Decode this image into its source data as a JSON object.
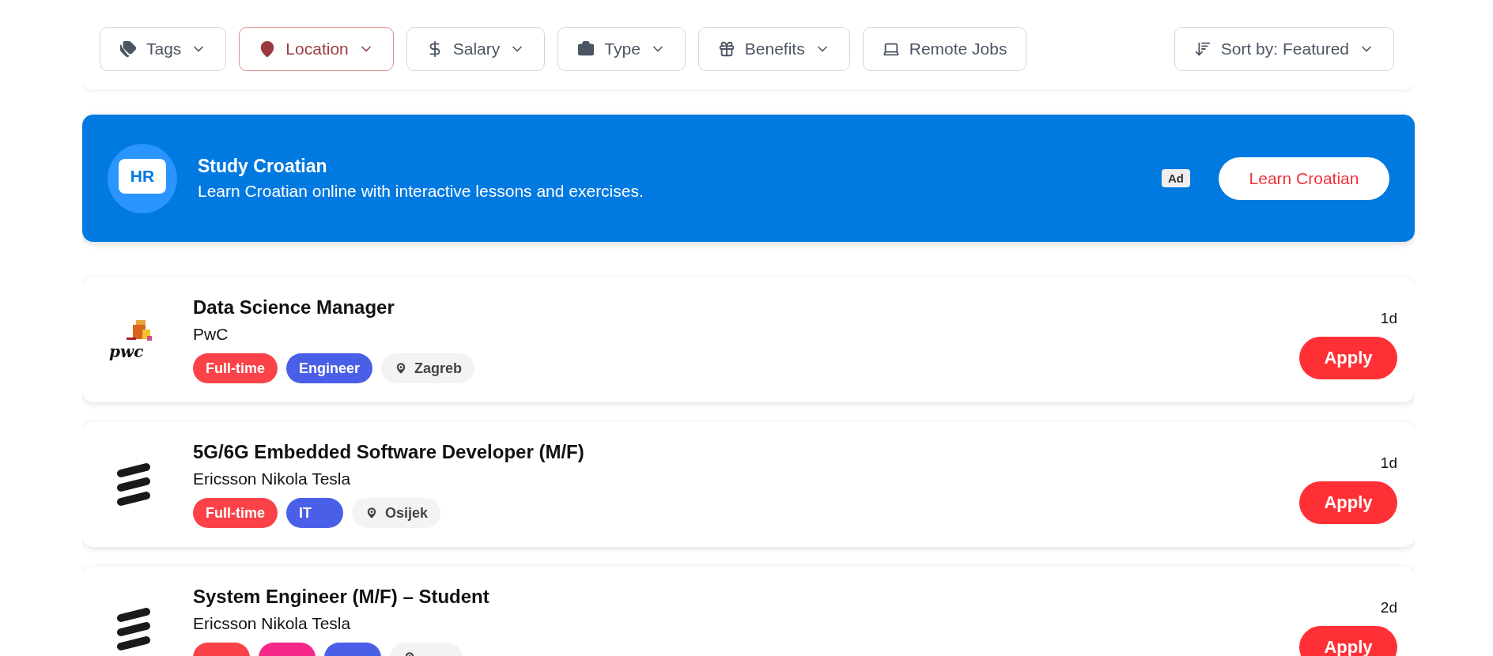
{
  "filters": [
    {
      "label": "Tags",
      "selected": false,
      "dropdown": true
    },
    {
      "label": "Location",
      "selected": true,
      "dropdown": true
    },
    {
      "label": "Salary",
      "selected": false,
      "dropdown": true
    },
    {
      "label": "Type",
      "selected": false,
      "dropdown": true
    },
    {
      "label": "Benefits",
      "selected": false,
      "dropdown": true
    },
    {
      "label": "Remote Jobs",
      "selected": false,
      "dropdown": false
    }
  ],
  "sort": {
    "label": "Sort by: Featured"
  },
  "ad": {
    "icon_text": "HR",
    "title": "Study Croatian",
    "description": "Learn Croatian online with interactive lessons and exercises.",
    "badge": "Ad",
    "button": "Learn Croatian"
  },
  "jobs": [
    {
      "title": "Data Science Manager",
      "company": "PwC",
      "logo": {
        "kind": "pwc",
        "text": "pwc"
      },
      "age": "1d",
      "apply": "Apply",
      "tags": [
        {
          "kind": "tag",
          "label": "Full-time",
          "color": "#fa4248"
        },
        {
          "kind": "tag",
          "label": "Engineer",
          "color": "#4a5fe8"
        },
        {
          "kind": "location",
          "label": "Zagreb"
        }
      ]
    },
    {
      "title": "5G/6G Embedded Software Developer (M/F)",
      "company": "Ericsson Nikola Tesla",
      "logo": {
        "kind": "bars"
      },
      "age": "1d",
      "apply": "Apply",
      "tags": [
        {
          "kind": "tag",
          "label": "Full-time",
          "color": "#fa4248"
        },
        {
          "kind": "tag",
          "label": "IT",
          "color": "#4a5fe8"
        },
        {
          "kind": "location",
          "label": "Osijek"
        }
      ]
    },
    {
      "title": "System Engineer (M/F) – Student",
      "company": "Ericsson Nikola Tesla",
      "logo": {
        "kind": "bars"
      },
      "age": "2d",
      "apply": "Apply",
      "tags": [
        {
          "kind": "tag",
          "color": "#fa4248"
        },
        {
          "kind": "tag",
          "color": "#f5288a"
        },
        {
          "kind": "tag",
          "color": "#4a5fe8"
        },
        {
          "kind": "location"
        }
      ]
    }
  ]
}
